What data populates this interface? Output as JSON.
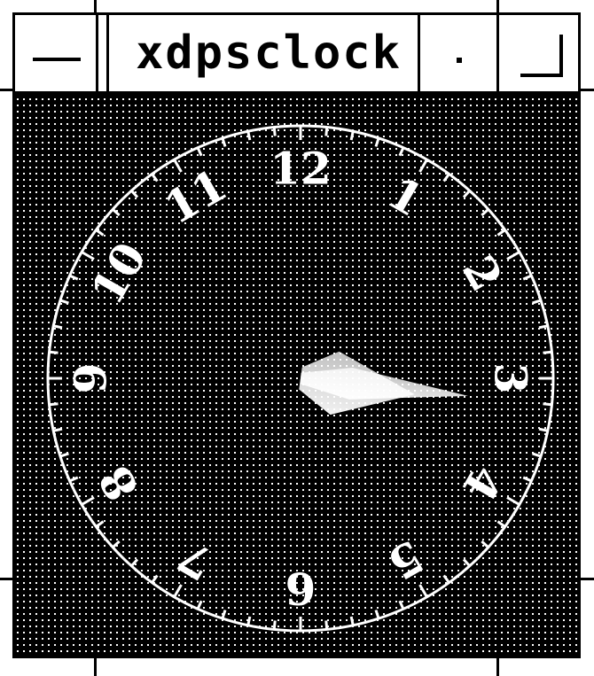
{
  "window": {
    "title": "xdpsclock",
    "buttons": {
      "menu_icon": "minimize-bar-icon",
      "iconify_icon": "dot-icon",
      "maximize_icon": "maximize-corner-icon"
    }
  },
  "clock": {
    "numerals": [
      "12",
      "1",
      "2",
      "3",
      "4",
      "5",
      "6",
      "7",
      "8",
      "9",
      "10",
      "11"
    ],
    "time": {
      "hour": 3,
      "minute": 16
    },
    "colors": {
      "face": "#000000",
      "markings": "#ffffff",
      "dots": "#ffffff"
    }
  }
}
